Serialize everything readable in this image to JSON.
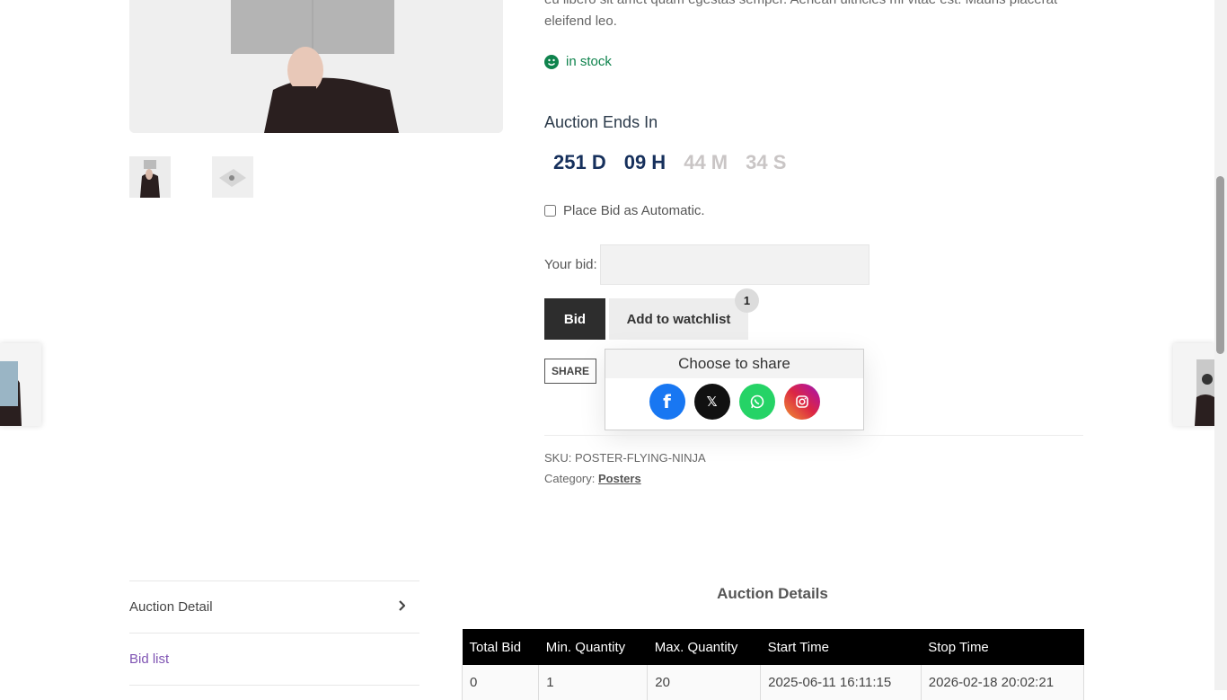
{
  "product": {
    "description_line1": "eu libero sit amet quam egestas semper. Aenean ultricies mi vitae est. Mauris placerat",
    "description_line2": "eleifend leo.",
    "stock": "in stock",
    "auction_ends_label": "Auction Ends In",
    "countdown": {
      "days": "251 D",
      "hours": "09 H",
      "minutes": "44 M",
      "seconds": "34 S"
    },
    "auto_bid_label": "Place Bid as Automatic.",
    "your_bid_label": "Your bid:",
    "bid_button": "Bid",
    "watchlist_button": "Add to watchlist",
    "watchlist_count": "1",
    "share_button": "SHARE",
    "share_popup": {
      "title": "Choose to share",
      "icons": [
        "facebook-icon",
        "x-icon",
        "whatsapp-icon",
        "instagram-icon"
      ]
    },
    "sku_label": "SKU:",
    "sku_value": "POSTER-FLYING-NINJA",
    "category_label": "Category:",
    "category_value": "Posters"
  },
  "tabs": [
    {
      "label": "Auction Detail"
    },
    {
      "label": "Bid list"
    }
  ],
  "details": {
    "title": "Auction Details",
    "columns": [
      "Total Bid",
      "Min. Quantity",
      "Max. Quantity",
      "Start Time",
      "Stop Time"
    ],
    "rows": [
      [
        "0",
        "1",
        "20",
        "2025-06-11 16:11:15",
        "2026-02-18 20:02:21"
      ]
    ]
  },
  "colors": {
    "stock_green": "#0f834d",
    "countdown_dark": "#16305c",
    "tab_active": "#7f54b3",
    "facebook": "#1877f2",
    "whatsapp": "#25d366"
  }
}
